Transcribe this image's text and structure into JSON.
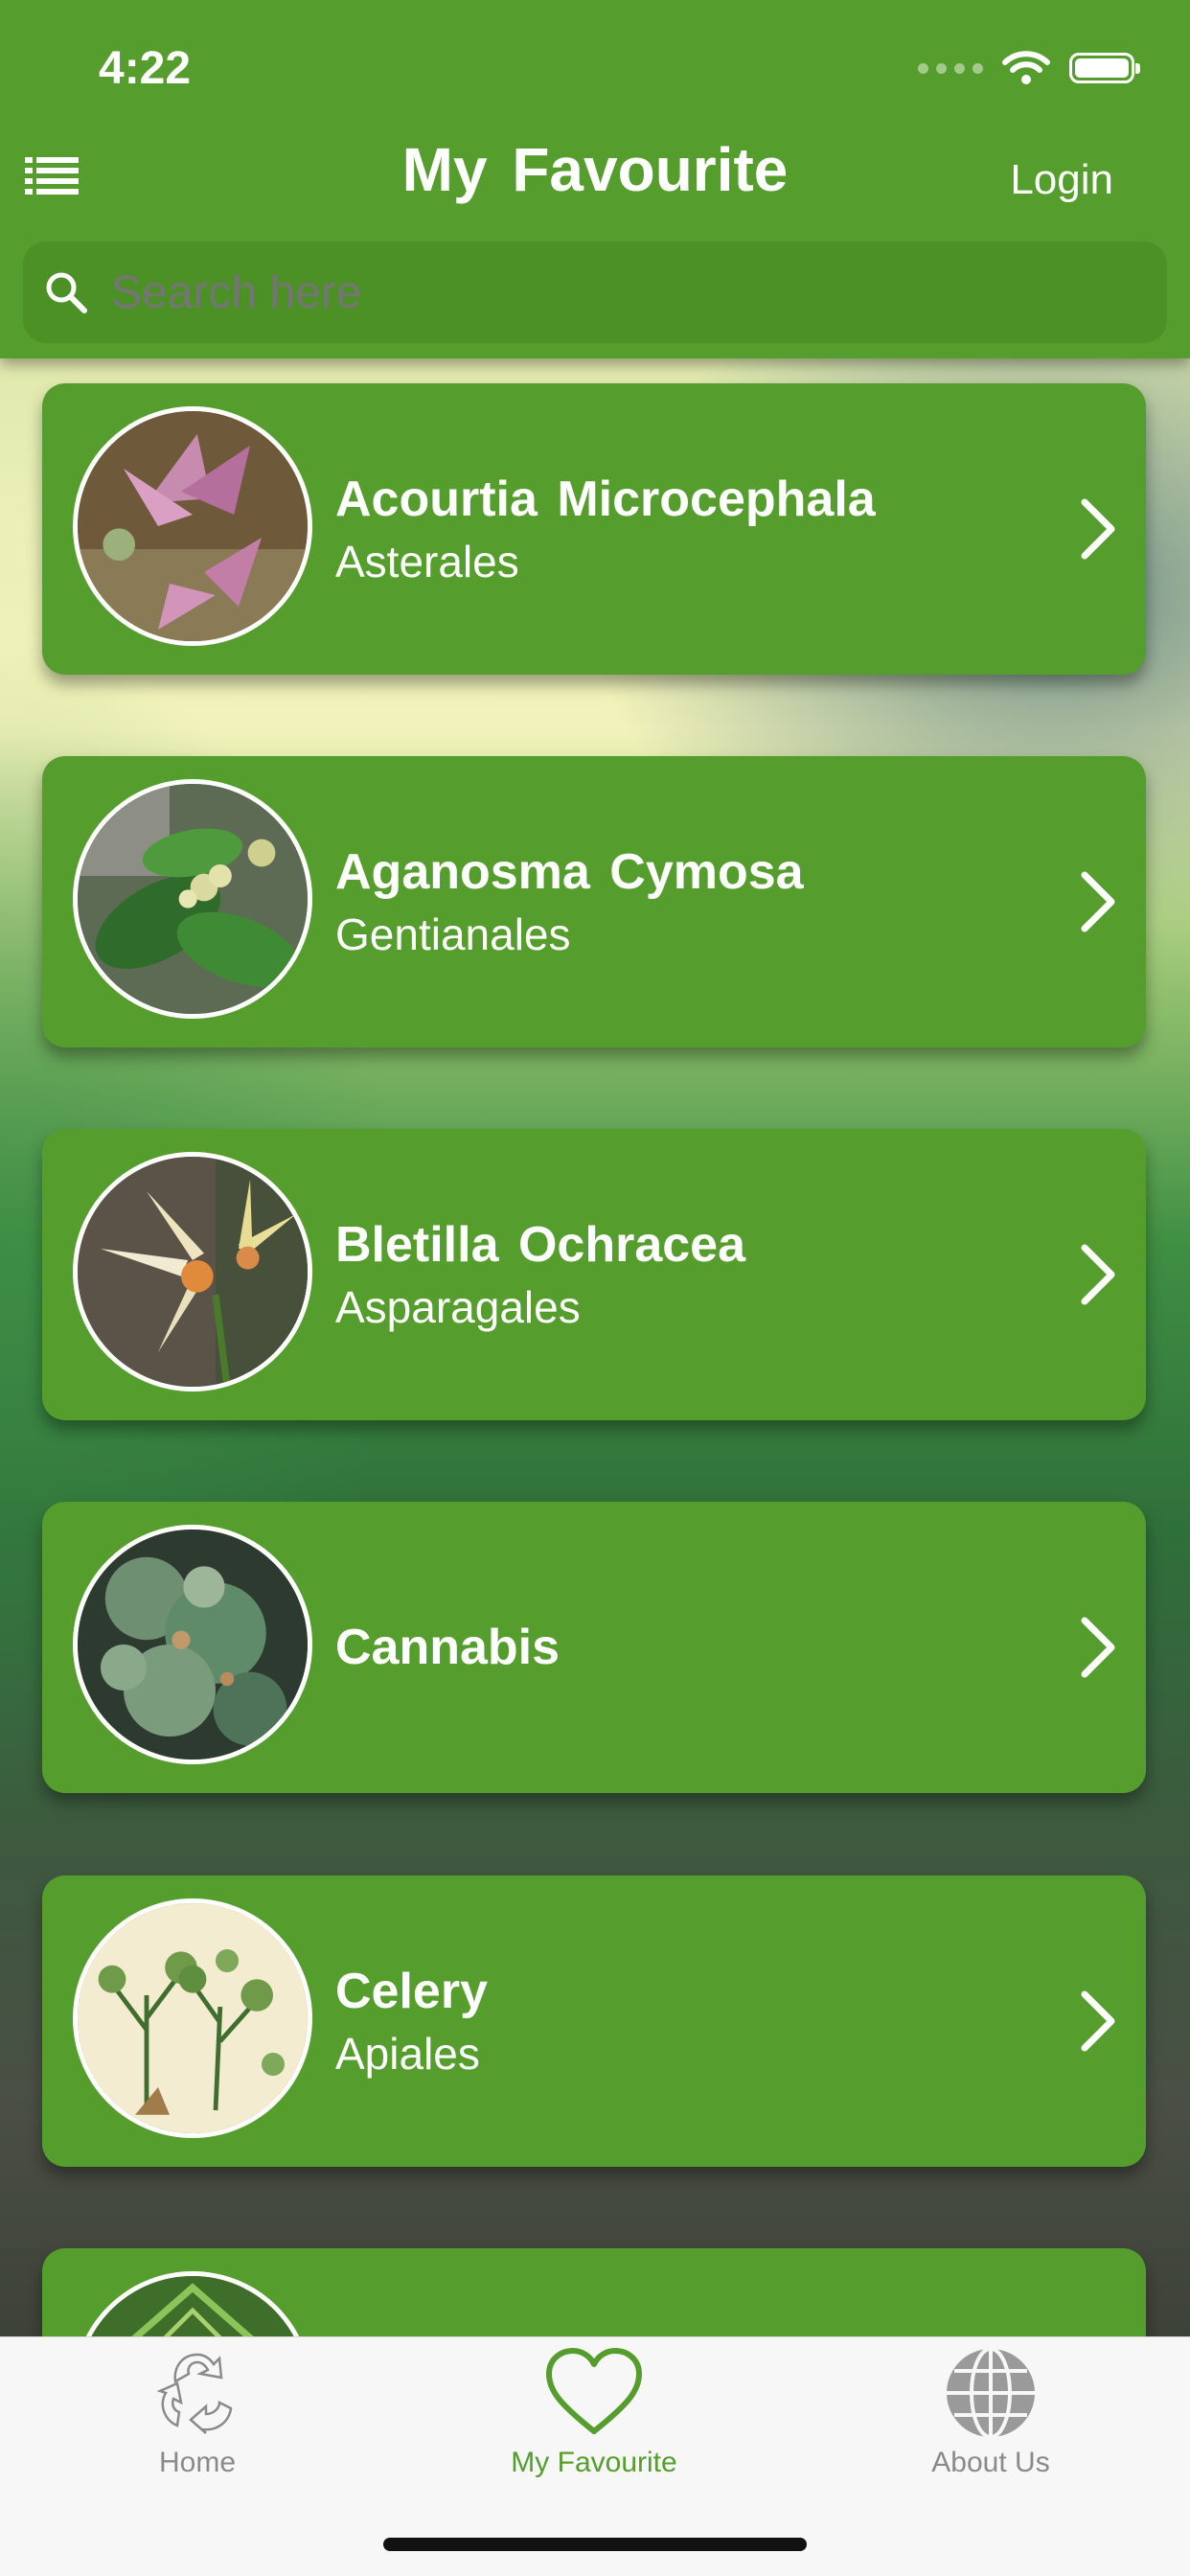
{
  "status_bar": {
    "time": "4:22"
  },
  "header": {
    "title": "My Favourite",
    "login_label": "Login",
    "menu_icon": "list-icon"
  },
  "search": {
    "placeholder": "Search here",
    "icon": "search-icon"
  },
  "plants": [
    {
      "name": "Acourtia Microcephala",
      "order": "Asterales"
    },
    {
      "name": "Aganosma Cymosa",
      "order": "Gentianales"
    },
    {
      "name": "Bletilla Ochracea",
      "order": "Asparagales"
    },
    {
      "name": "Cannabis",
      "order": ""
    },
    {
      "name": "Celery",
      "order": "Apiales"
    }
  ],
  "tabs": [
    {
      "label": "Home",
      "icon": "recycle-leaf-icon"
    },
    {
      "label": "My Favourite",
      "icon": "heart-icon"
    },
    {
      "label": "About Us",
      "icon": "globe-icon"
    }
  ],
  "colors": {
    "brand_green": "#559e2d",
    "search_green": "#4c9125",
    "tab_inactive": "#8a8a8a"
  }
}
